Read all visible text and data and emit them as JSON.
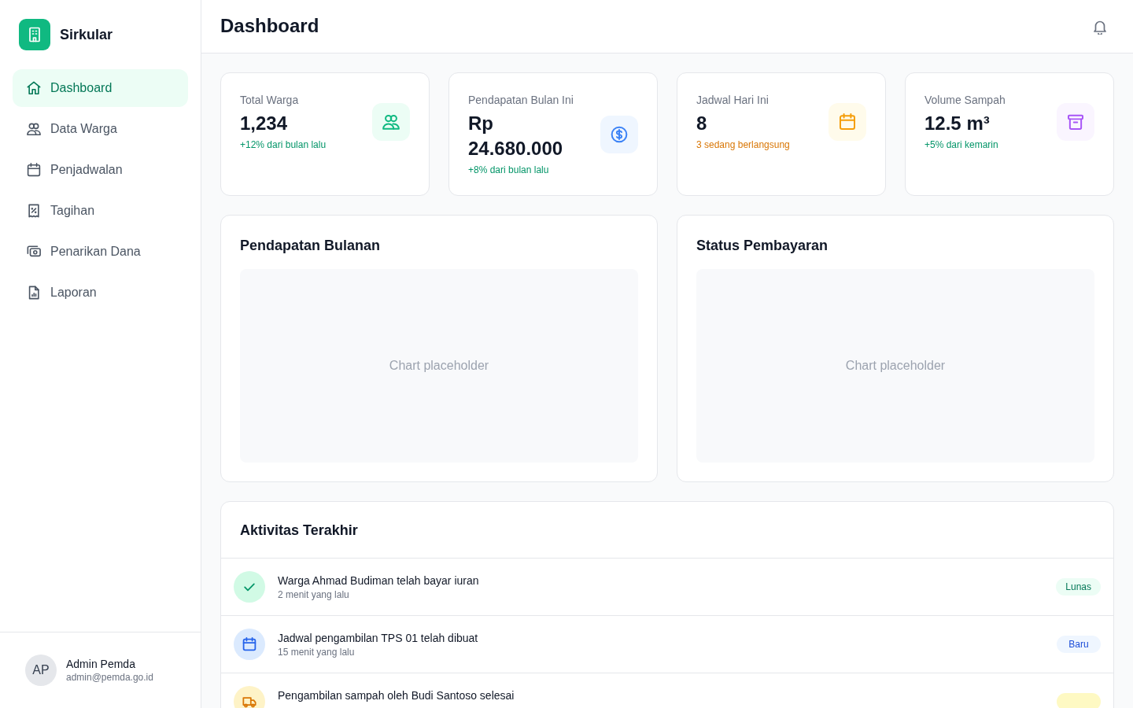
{
  "app": {
    "name": "Sirkular"
  },
  "sidebar": {
    "items": [
      {
        "label": "Dashboard",
        "selected": true
      },
      {
        "label": "Data Warga",
        "selected": false
      },
      {
        "label": "Penjadwalan",
        "selected": false
      },
      {
        "label": "Tagihan",
        "selected": false
      },
      {
        "label": "Penarikan Dana",
        "selected": false
      },
      {
        "label": "Laporan",
        "selected": false
      }
    ]
  },
  "user": {
    "initials": "AP",
    "name": "Admin Pemda",
    "email": "admin@pemda.go.id"
  },
  "header": {
    "title": "Dashboard"
  },
  "stats": [
    {
      "kind": "residents",
      "label": "Total Warga",
      "value": "1,234",
      "note": "+12% dari bulan lalu"
    },
    {
      "kind": "revenue",
      "label": "Pendapatan Bulan Ini",
      "value": "Rp 24.680.000",
      "note": "+8% dari bulan lalu"
    },
    {
      "kind": "schedules",
      "label": "Jadwal Hari Ini",
      "value": "8",
      "note": "3 sedang berlangsung"
    },
    {
      "kind": "waste",
      "label": "Volume Sampah",
      "value": "12.5 m³",
      "note": "+5% dari kemarin"
    }
  ],
  "charts": [
    {
      "title": "Pendapatan Bulanan",
      "empty_text": "Chart placeholder"
    },
    {
      "title": "Status Pembayaran",
      "empty_text": "Chart placeholder"
    }
  ],
  "activity": {
    "title": "Aktivitas Terakhir",
    "items": [
      {
        "kind": "payment",
        "text": "Warga Ahmad Budiman telah bayar iuran",
        "time": "2 menit yang lalu",
        "badge": "Lunas"
      },
      {
        "kind": "schedule",
        "text": "Jadwal pengambilan TPS 01 telah dibuat",
        "time": "15 menit yang lalu",
        "badge": "Baru"
      },
      {
        "kind": "pickup",
        "text": "Pengambilan sampah oleh Budi Santoso selesai"
      }
    ]
  }
}
